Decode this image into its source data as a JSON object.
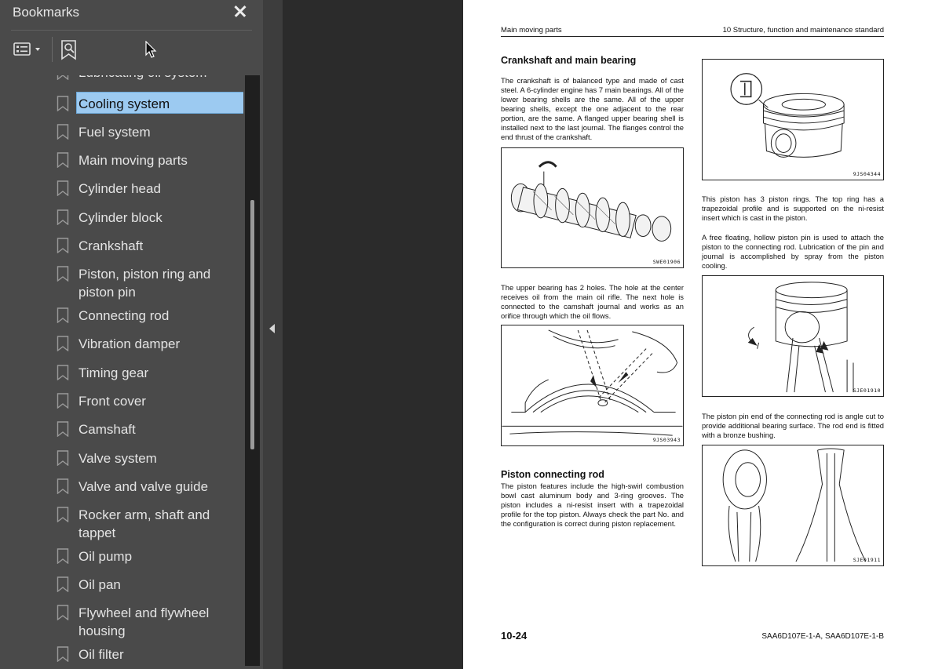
{
  "panel": {
    "title": "Bookmarks",
    "icons": [
      "close-icon",
      "list-options-icon",
      "chevron-down-icon",
      "find-bookmark-icon",
      "bookmark-icon",
      "mouse-pointer-icon",
      "collapse-panel-icon"
    ],
    "items": [
      {
        "label": "Lubricating oil system"
      },
      {
        "label": "Cooling system",
        "selected": true
      },
      {
        "label": "Fuel system"
      },
      {
        "label": "Main moving parts"
      },
      {
        "label": "Cylinder head"
      },
      {
        "label": "Cylinder block"
      },
      {
        "label": "Crankshaft"
      },
      {
        "label": "Piston, piston ring and piston pin"
      },
      {
        "label": "Connecting rod"
      },
      {
        "label": "Vibration damper"
      },
      {
        "label": "Timing gear"
      },
      {
        "label": "Front cover"
      },
      {
        "label": "Camshaft"
      },
      {
        "label": "Valve system"
      },
      {
        "label": "Valve and valve guide"
      },
      {
        "label": "Rocker arm, shaft and tappet"
      },
      {
        "label": "Oil pump"
      },
      {
        "label": "Oil pan"
      },
      {
        "label": "Flywheel and flywheel housing"
      },
      {
        "label": "Oil filter"
      }
    ]
  },
  "page": {
    "header_left": "Main moving parts",
    "header_right": "10 Structure, function and maintenance standard",
    "section1_title": "Crankshaft and main bearing",
    "section1_text": "The crankshaft is of balanced type and made of cast steel. A 6-cylinder engine has 7 main bearings. All of the lower bearing shells are the same. All of the upper bearing shells, except the one adjacent to the rear portion, are the same. A flanged upper bearing shell is installed next to the last journal. The flanges control the end thrust of the crankshaft.",
    "fig1_id": "SWE01906",
    "bearing_text": "The upper bearing has 2 holes. The hole at the center receives oil from the main oil rifle. The next hole is connected to the camshaft journal and works as an orifice through which the oil flows.",
    "fig2_id": "9JS03943",
    "section2_title": "Piston connecting rod",
    "section2_text": "The piston features include the high-swirl combustion bowl cast aluminum body and 3-ring grooves. The piston includes a ni-resist insert with a trapezoidal profile for the top piston. Always check the part No. and the configuration is correct during piston replacement.",
    "fig3_id": "9JS04344",
    "piston_rings_text": "This piston has 3 piston rings. The top ring has a trapezoidal profile and is supported on the ni-resist insert which is cast in the piston.",
    "piston_pin_text": "A free floating, hollow piston pin is used to attach the piston to the connecting rod. Lubrication of the pin and journal is accomplished by spray from the piston cooling.",
    "fig4_id": "SJE01910",
    "rod_text": "The piston pin end of the connecting rod is angle cut to provide additional bearing surface. The rod end is fitted with a bronze bushing.",
    "fig5_id": "SJE01911",
    "page_number": "10-24",
    "model_numbers": "SAA6D107E-1-A, SAA6D107E-1-B"
  }
}
